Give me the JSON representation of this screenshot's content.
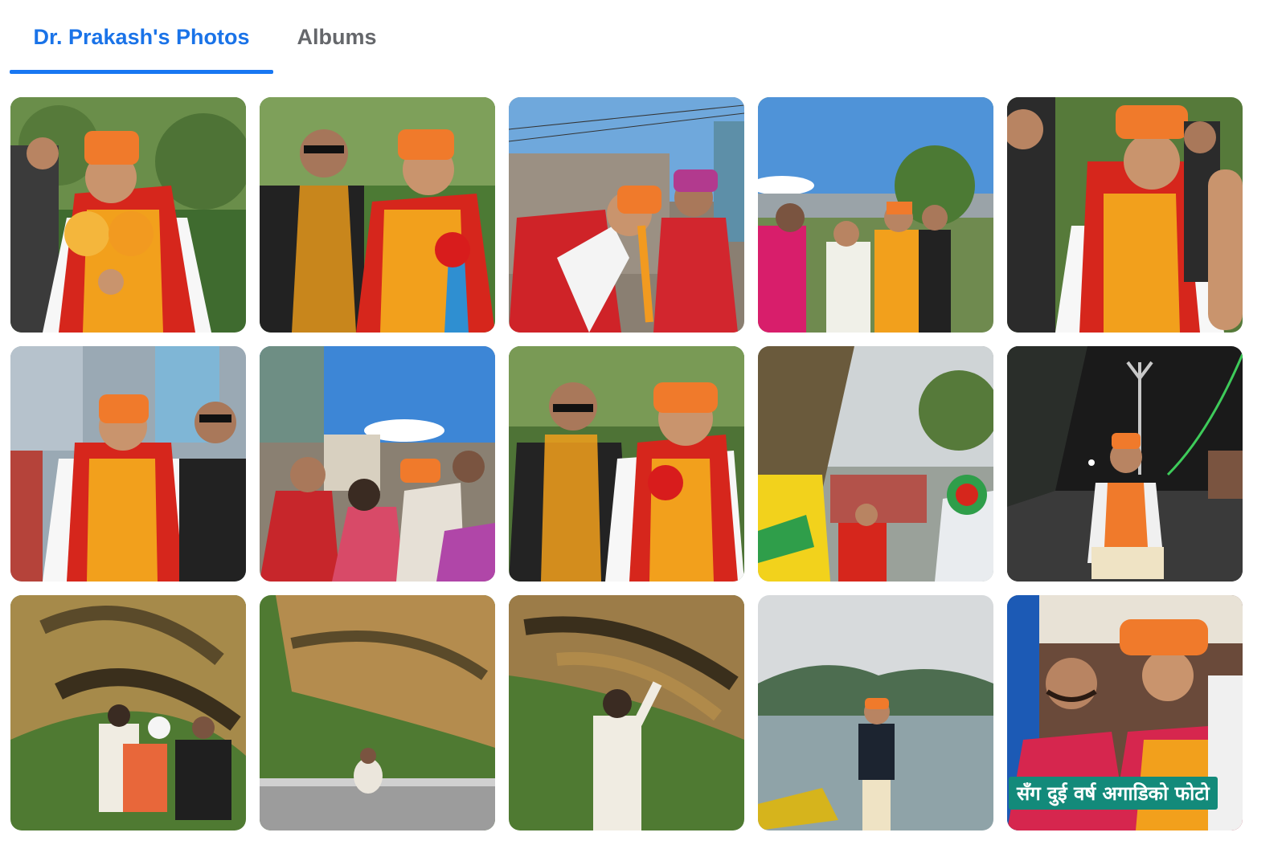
{
  "tabs": [
    {
      "label": "Dr. Prakash's Photos",
      "active": true
    },
    {
      "label": "Albums",
      "active": false
    }
  ],
  "colors": {
    "accent": "#1877f2",
    "tab_active_text": "#1a73e8",
    "tab_inactive_text": "#65676b"
  },
  "photos": [
    {
      "scene": "garland-greeting-man-in-orange-cap"
    },
    {
      "scene": "garland-greeting-with-security"
    },
    {
      "scene": "bowing-to-elder-woman"
    },
    {
      "scene": "crowd-street-welcome"
    },
    {
      "scene": "garlanded-man-closeup"
    },
    {
      "scene": "garlanded-man-with-guard"
    },
    {
      "scene": "women-blessing-on-street"
    },
    {
      "scene": "two-men-with-garlands"
    },
    {
      "scene": "festival-procession"
    },
    {
      "scene": "namaste-at-night-shrine"
    },
    {
      "scene": "rock-overhang-group"
    },
    {
      "scene": "person-bowing-under-rock"
    },
    {
      "scene": "man-pointing-at-rock"
    },
    {
      "scene": "man-on-boat-lake"
    },
    {
      "scene": "two-men-smiling-with-text",
      "caption": "सँग दुई वर्ष अगाडिको फोटो"
    }
  ]
}
